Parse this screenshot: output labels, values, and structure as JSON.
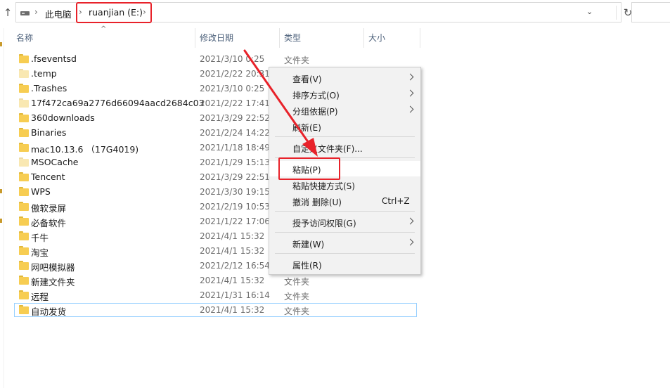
{
  "address_bar": {
    "breadcrumb": [
      "此电脑",
      "ruanjian (E:)"
    ]
  },
  "columns": {
    "name": "名称",
    "date": "修改日期",
    "type": "类型",
    "size": "大小"
  },
  "files": [
    {
      "name": ".fseventsd",
      "date": "2021/3/10 0:25",
      "type": "文件夹"
    },
    {
      "name": ".temp",
      "date": "2021/2/22 20:31",
      "type": ""
    },
    {
      "name": ".Trashes",
      "date": "2021/3/10 0:25",
      "type": ""
    },
    {
      "name": "17f472ca69a2776d66094aacd2684c03",
      "date": "2021/2/22 17:41",
      "type": ""
    },
    {
      "name": "360downloads",
      "date": "2021/3/29 22:52",
      "type": ""
    },
    {
      "name": "Binaries",
      "date": "2021/2/24 14:22",
      "type": ""
    },
    {
      "name": "mac10.13.6 （17G4019)",
      "date": "2021/1/18 18:49",
      "type": ""
    },
    {
      "name": "MSOCache",
      "date": "2021/1/29 15:13",
      "type": ""
    },
    {
      "name": "Tencent",
      "date": "2021/3/29 22:51",
      "type": ""
    },
    {
      "name": "WPS",
      "date": "2021/3/30 19:15",
      "type": ""
    },
    {
      "name": "傲软录屏",
      "date": "2021/2/19 10:53",
      "type": ""
    },
    {
      "name": "必备软件",
      "date": "2021/1/22 17:06",
      "type": ""
    },
    {
      "name": "千牛",
      "date": "2021/4/1 15:32",
      "type": ""
    },
    {
      "name": "淘宝",
      "date": "2021/4/1 15:32",
      "type": ""
    },
    {
      "name": "网吧模拟器",
      "date": "2021/2/12 16:54",
      "type": ""
    },
    {
      "name": "新建文件夹",
      "date": "2021/4/1 15:32",
      "type": "文件夹"
    },
    {
      "name": "远程",
      "date": "2021/1/31 16:14",
      "type": "文件夹"
    },
    {
      "name": "自动发货",
      "date": "2021/4/1 15:32",
      "type": "文件夹"
    }
  ],
  "context_menu": {
    "view": "查看(V)",
    "sort": "排序方式(O)",
    "group": "分组依据(P)",
    "refresh": "刷新(E)",
    "customize": "自定义文件夹(F)...",
    "paste": "粘贴(P)",
    "paste_shortcut": "粘贴快捷方式(S)",
    "undo_delete": "撤消 删除(U)",
    "undo_shortcut": "Ctrl+Z",
    "grant_access": "授予访问权限(G)",
    "new": "新建(W)",
    "properties": "属性(R)"
  },
  "colors": {
    "annotation_red": "#e8222a",
    "folder_yellow": "#f7cd52",
    "selection_border": "#99d1ff"
  }
}
